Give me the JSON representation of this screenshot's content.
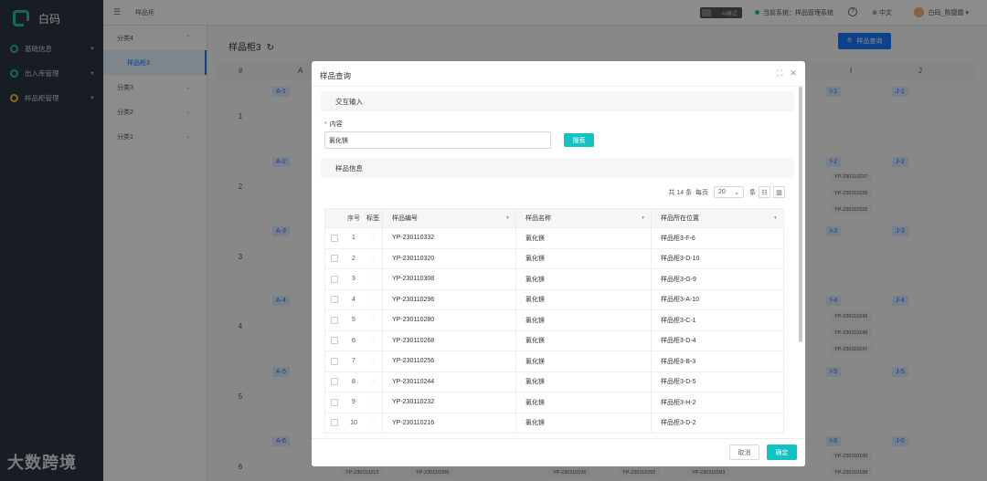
{
  "app": {
    "name": "白码"
  },
  "sidebar": {
    "items": [
      {
        "label": "基础信息"
      },
      {
        "label": "出入库管理"
      },
      {
        "label": "样品柜管理"
      }
    ],
    "watermark": "大数跨境"
  },
  "topbar": {
    "breadcrumb": "样品柜",
    "ai_mode": "AI模式",
    "current_system": "当前系统：样品管理系统",
    "language": "中文",
    "user": "白码_陈捷霞"
  },
  "categories": {
    "items": [
      {
        "label": "分类4"
      },
      {
        "label": "样品柜3"
      },
      {
        "label": "分类3"
      },
      {
        "label": "分类2"
      },
      {
        "label": "分类1"
      }
    ]
  },
  "main": {
    "title": "样品柜3",
    "query_button": "样品查询",
    "col_hash": "#",
    "col_a": "A",
    "col_i": "I",
    "col_j": "J",
    "rows": [
      "1",
      "2",
      "3",
      "4",
      "5",
      "6"
    ],
    "cells_a": [
      "A-1",
      "A-2",
      "A-3",
      "A-4",
      "A-5",
      "A-6"
    ],
    "cells_i": [
      "I-1",
      "I-2",
      "I-3",
      "I-4",
      "I-5",
      "I-6"
    ],
    "cells_j": [
      "J-1",
      "J-2",
      "J-3",
      "J-4",
      "J-5",
      "J-6"
    ],
    "chips_i2": [
      "YP-230110237",
      "YP-230110236",
      "YP-230110235"
    ],
    "chips_i4": [
      "YP-230110249",
      "YP-230110248",
      "YP-230110247"
    ],
    "chips_i6": [
      "YP-230110190",
      "YP-230110189"
    ],
    "chips_bottom": [
      "YP-230110213",
      "YP-230110206",
      "YP-230110196",
      "YP-230110292",
      "YP-230110183"
    ]
  },
  "modal": {
    "title": "样品查询",
    "section_input": "交互输入",
    "field_label": "内容",
    "field_value": "氯化镁",
    "search_button": "搜索",
    "section_info": "样品信息",
    "total": "共 14 条",
    "per_page_label": "每页",
    "per_page": "20",
    "unit": "条",
    "headers": {
      "idx": "序号",
      "tag": "标签",
      "code": "样品编号",
      "name": "样品名称",
      "loc": "样品所在位置"
    },
    "rows": [
      {
        "idx": "1",
        "code": "YP-230110332",
        "name": "氯化镁",
        "loc": "样品柜3-F-6"
      },
      {
        "idx": "2",
        "code": "YP-230110320",
        "name": "氯化镁",
        "loc": "样品柜3-D-10"
      },
      {
        "idx": "3",
        "code": "YP-230110308",
        "name": "氯化镁",
        "loc": "样品柜3-G-9"
      },
      {
        "idx": "4",
        "code": "YP-230110296",
        "name": "氯化镁",
        "loc": "样品柜3-A-10"
      },
      {
        "idx": "5",
        "code": "YP-230110280",
        "name": "氯化镁",
        "loc": "样品柜3-C-1"
      },
      {
        "idx": "6",
        "code": "YP-230110268",
        "name": "氯化镁",
        "loc": "样品柜3-D-4"
      },
      {
        "idx": "7",
        "code": "YP-230110256",
        "name": "氯化镁",
        "loc": "样品柜3-B-3"
      },
      {
        "idx": "8",
        "code": "YP-230110244",
        "name": "氯化镁",
        "loc": "样品柜3-D-5"
      },
      {
        "idx": "9",
        "code": "YP-230110232",
        "name": "氯化镁",
        "loc": "样品柜3-H-2"
      },
      {
        "idx": "10",
        "code": "YP-230110216",
        "name": "氯化镁",
        "loc": "样品柜3-D-2"
      }
    ],
    "cancel": "取消",
    "ok": "确定"
  }
}
